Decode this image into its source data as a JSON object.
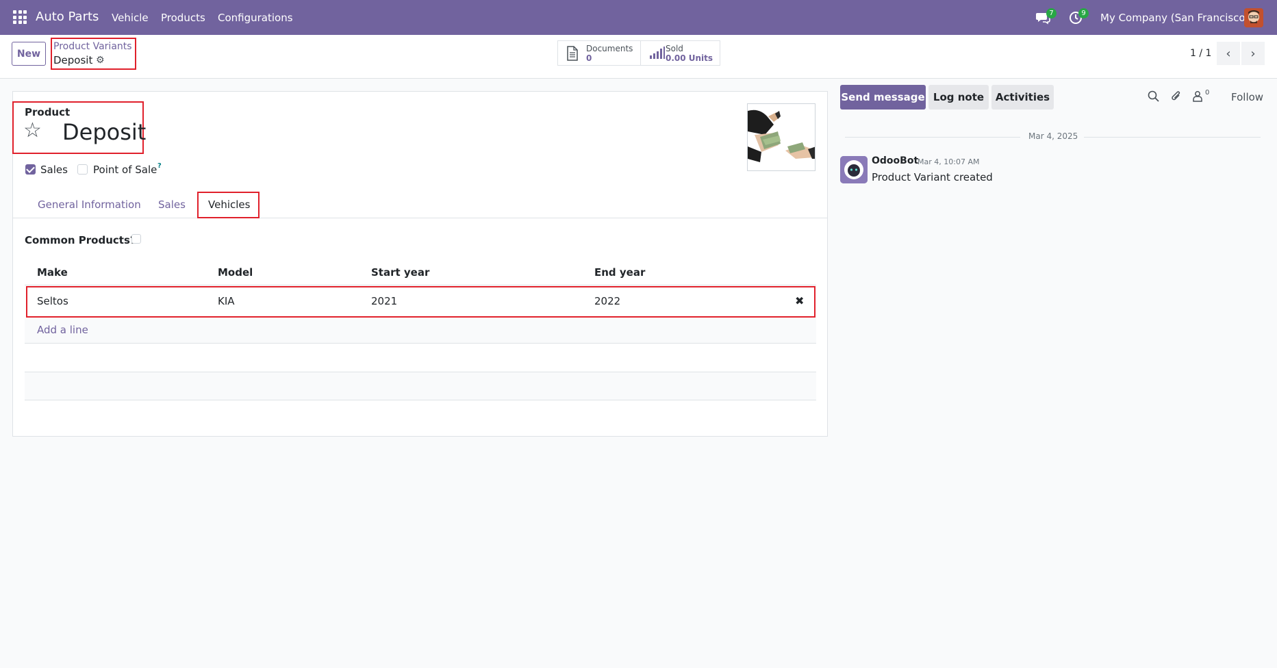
{
  "navbar": {
    "app_name": "Auto Parts",
    "menus": [
      "Vehicle",
      "Products",
      "Configurations"
    ],
    "messages_badge": "7",
    "activities_badge": "9",
    "company": "My Company (San Francisco)"
  },
  "control_panel": {
    "new_label": "New",
    "breadcrumb_parent": "Product Variants",
    "breadcrumb_current": "Deposit",
    "documents_label": "Documents",
    "documents_value": "0",
    "sold_label": "Sold",
    "sold_value": "0.00 Units",
    "pager": "1 / 1"
  },
  "form": {
    "product_label": "Product",
    "product_name": "Deposit",
    "sales_label": "Sales",
    "sales_checked": true,
    "pos_label": "Point of Sale",
    "pos_help": "?",
    "pos_checked": false,
    "tabs": [
      "General Information",
      "Sales",
      "Vehicles"
    ],
    "active_tab": "Vehicles",
    "common_products_label": "Common Products?",
    "table": {
      "columns": [
        "Make",
        "Model",
        "Start year",
        "End year"
      ],
      "rows": [
        {
          "make": "Seltos",
          "model": "KIA",
          "start_year": "2021",
          "end_year": "2022"
        }
      ],
      "add_line": "Add a line"
    }
  },
  "chatter": {
    "send_message": "Send message",
    "log_note": "Log note",
    "activities": "Activities",
    "followers_count": "0",
    "follow": "Follow",
    "date_separator": "Mar 4, 2025",
    "message": {
      "author": "OdooBot",
      "time": "Mar 4, 10:07 AM",
      "body": "Product Variant created"
    }
  },
  "colors": {
    "brand": "#71639e",
    "highlight": "#e0202b",
    "badge": "#28a745"
  }
}
